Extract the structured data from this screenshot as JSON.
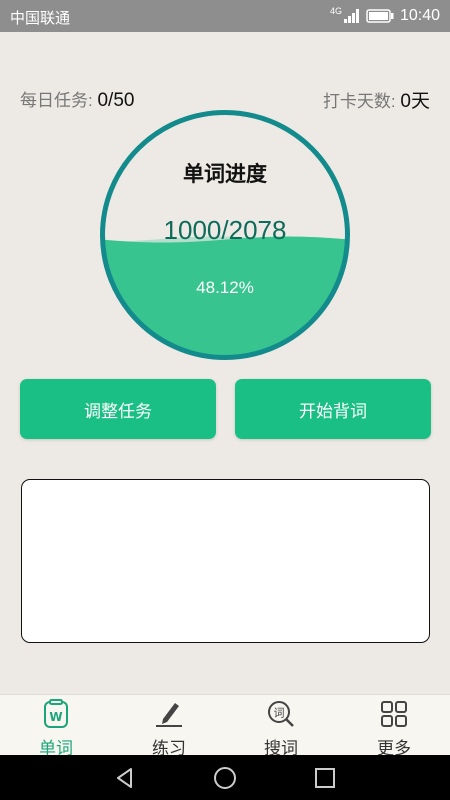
{
  "status_bar": {
    "carrier": "中国联通",
    "network": "4G",
    "time": "10:40"
  },
  "stats": {
    "daily_task_label": "每日任务:",
    "daily_task_value": "0/50",
    "checkin_label": "打卡天数:",
    "checkin_value": "0",
    "checkin_unit": "天"
  },
  "progress": {
    "title": "单词进度",
    "count_text": "1000/2078",
    "percent_text": "48.12%",
    "fraction": 0.4812
  },
  "buttons": {
    "adjust_task": "调整任务",
    "start_memorize": "开始背词"
  },
  "tabs": [
    {
      "label": "单词",
      "icon": "word-book-icon",
      "active": true
    },
    {
      "label": "练习",
      "icon": "pencil-icon",
      "active": false
    },
    {
      "label": "搜词",
      "icon": "search-word-icon",
      "active": false
    },
    {
      "label": "更多",
      "icon": "grid-icon",
      "active": false
    }
  ],
  "colors": {
    "accent": "#1abf85",
    "ring": "#138a8c",
    "wave": "#37c48f",
    "background": "#ede9e5"
  }
}
